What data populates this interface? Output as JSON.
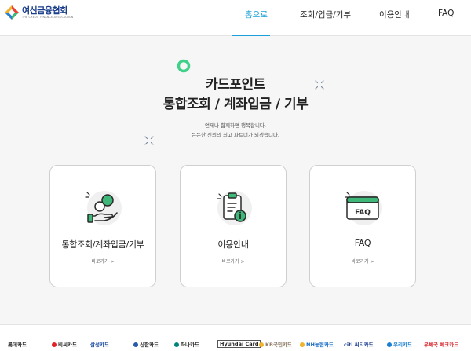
{
  "header": {
    "logo_title": "여신금융협회",
    "logo_subtitle": "THE CREDIT FINANCE ASSOCIATION",
    "nav": [
      {
        "label": "홈으로",
        "active": true
      },
      {
        "label": "조회/입금/기부",
        "active": false
      },
      {
        "label": "이용안내",
        "active": false
      },
      {
        "label": "FAQ",
        "active": false
      }
    ]
  },
  "hero": {
    "title_line1": "카드포인트",
    "title_line2": "통합조회 / 계좌입금 / 기부",
    "desc_line1": "언제나 함께하면 행복합니다.",
    "desc_line2": "든든한 신뢰의 최고 파트너가 되겠습니다."
  },
  "cards": [
    {
      "title": "통합조회/계좌입금/기부",
      "link": "바로가기 >",
      "icon": "coin-hand-icon"
    },
    {
      "title": "이용안내",
      "link": "바로가기 >",
      "icon": "clipboard-info-icon"
    },
    {
      "title": "FAQ",
      "link": "바로가기 >",
      "icon": "faq-window-icon"
    }
  ],
  "partners": [
    {
      "label": "롯데카드",
      "color": "#333333"
    },
    {
      "label": "비씨카드",
      "color": "#e2232a"
    },
    {
      "label": "삼성카드",
      "color": "#1b4da1"
    },
    {
      "label": "신한카드",
      "color": "#2a5aa8"
    },
    {
      "label": "하나카드",
      "color": "#00857a"
    },
    {
      "label": "Hyundai Card",
      "color": "#222222"
    },
    {
      "label": "KB국민카드",
      "color": "#8a7a63"
    },
    {
      "label": "NH농협카드",
      "color": "#1a6fc4"
    },
    {
      "label": "citi 씨티카드",
      "color": "#1b3f8f"
    },
    {
      "label": "우리카드",
      "color": "#1a7fd1"
    },
    {
      "label": "우체국 체크카드",
      "color": "#d6262c"
    }
  ],
  "colors": {
    "accent": "#1a9fd8",
    "icon_green": "#3fb779",
    "icon_dark": "#2a2a2a"
  }
}
